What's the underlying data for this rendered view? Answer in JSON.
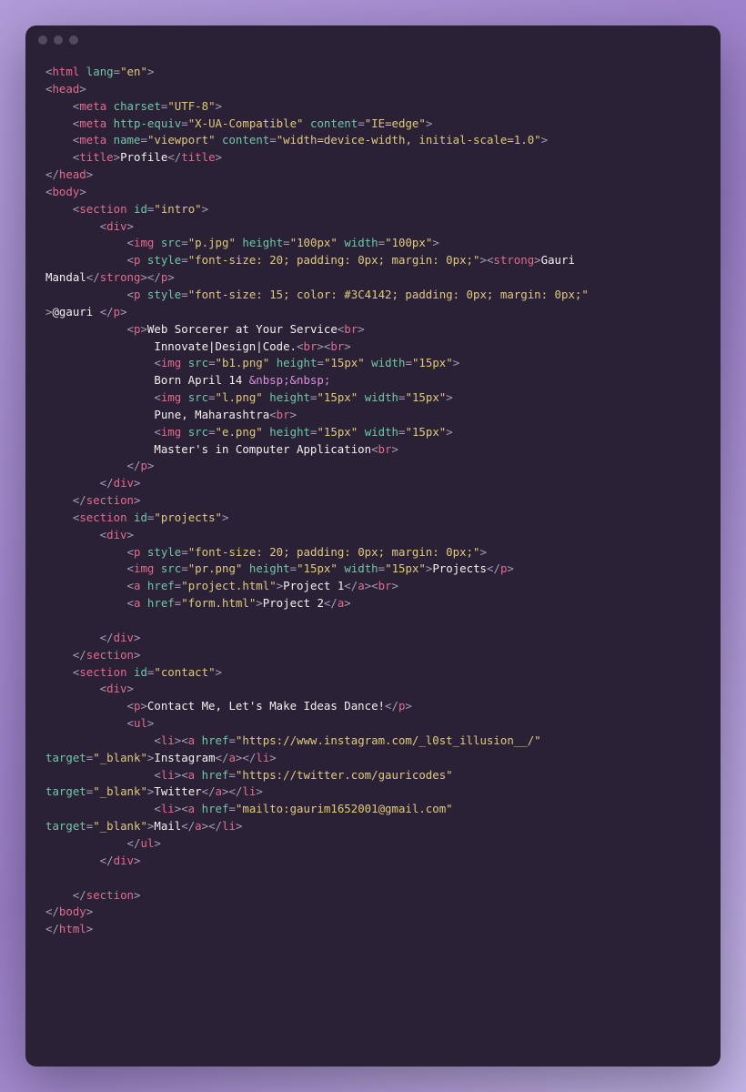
{
  "lines": [
    [
      [
        "c-punc",
        "<"
      ],
      [
        "c-tag",
        "html"
      ],
      [
        "c-punc",
        " "
      ],
      [
        "c-attr",
        "lang"
      ],
      [
        "c-punc",
        "="
      ],
      [
        "c-str",
        "\"en\""
      ],
      [
        "c-punc",
        ">"
      ]
    ],
    [
      [
        "c-punc",
        "<"
      ],
      [
        "c-tag",
        "head"
      ],
      [
        "c-punc",
        ">"
      ]
    ],
    [
      [
        "c-punc",
        "    <"
      ],
      [
        "c-tag",
        "meta"
      ],
      [
        "c-punc",
        " "
      ],
      [
        "c-attr",
        "charset"
      ],
      [
        "c-punc",
        "="
      ],
      [
        "c-str",
        "\"UTF-8\""
      ],
      [
        "c-punc",
        ">"
      ]
    ],
    [
      [
        "c-punc",
        "    <"
      ],
      [
        "c-tag",
        "meta"
      ],
      [
        "c-punc",
        " "
      ],
      [
        "c-attr",
        "http-equiv"
      ],
      [
        "c-punc",
        "="
      ],
      [
        "c-str",
        "\"X-UA-Compatible\""
      ],
      [
        "c-punc",
        " "
      ],
      [
        "c-attr",
        "content"
      ],
      [
        "c-punc",
        "="
      ],
      [
        "c-str",
        "\"IE=edge\""
      ],
      [
        "c-punc",
        ">"
      ]
    ],
    [
      [
        "c-punc",
        "    <"
      ],
      [
        "c-tag",
        "meta"
      ],
      [
        "c-punc",
        " "
      ],
      [
        "c-attr",
        "name"
      ],
      [
        "c-punc",
        "="
      ],
      [
        "c-str",
        "\"viewport\""
      ],
      [
        "c-punc",
        " "
      ],
      [
        "c-attr",
        "content"
      ],
      [
        "c-punc",
        "="
      ],
      [
        "c-str",
        "\"width=device-width, initial-scale=1.0\""
      ],
      [
        "c-punc",
        ">"
      ]
    ],
    [
      [
        "c-punc",
        "    <"
      ],
      [
        "c-tag",
        "title"
      ],
      [
        "c-punc",
        ">"
      ],
      [
        "c-text",
        "Profile"
      ],
      [
        "c-punc",
        "</"
      ],
      [
        "c-tag",
        "title"
      ],
      [
        "c-punc",
        ">"
      ]
    ],
    [
      [
        "c-punc",
        "</"
      ],
      [
        "c-tag",
        "head"
      ],
      [
        "c-punc",
        ">"
      ]
    ],
    [
      [
        "c-punc",
        "<"
      ],
      [
        "c-tag",
        "body"
      ],
      [
        "c-punc",
        ">"
      ]
    ],
    [
      [
        "c-punc",
        "    <"
      ],
      [
        "c-tag",
        "section"
      ],
      [
        "c-punc",
        " "
      ],
      [
        "c-attr",
        "id"
      ],
      [
        "c-punc",
        "="
      ],
      [
        "c-str",
        "\"intro\""
      ],
      [
        "c-punc",
        ">"
      ]
    ],
    [
      [
        "c-punc",
        "        <"
      ],
      [
        "c-tag",
        "div"
      ],
      [
        "c-punc",
        ">"
      ]
    ],
    [
      [
        "c-punc",
        "            <"
      ],
      [
        "c-tag",
        "img"
      ],
      [
        "c-punc",
        " "
      ],
      [
        "c-attr",
        "src"
      ],
      [
        "c-punc",
        "="
      ],
      [
        "c-str",
        "\"p.jpg\""
      ],
      [
        "c-punc",
        " "
      ],
      [
        "c-attr",
        "height"
      ],
      [
        "c-punc",
        "="
      ],
      [
        "c-str",
        "\"100px\""
      ],
      [
        "c-punc",
        " "
      ],
      [
        "c-attr",
        "width"
      ],
      [
        "c-punc",
        "="
      ],
      [
        "c-str",
        "\"100px\""
      ],
      [
        "c-punc",
        ">"
      ]
    ],
    [
      [
        "c-punc",
        "            <"
      ],
      [
        "c-tag",
        "p"
      ],
      [
        "c-punc",
        " "
      ],
      [
        "c-attr",
        "style"
      ],
      [
        "c-punc",
        "="
      ],
      [
        "c-str",
        "\"font-size: 20; padding: 0px; margin: 0px;\""
      ],
      [
        "c-punc",
        "><"
      ],
      [
        "c-tag",
        "strong"
      ],
      [
        "c-punc",
        ">"
      ],
      [
        "c-text",
        "Gauri "
      ]
    ],
    [
      [
        "c-text",
        "Mandal"
      ],
      [
        "c-punc",
        "</"
      ],
      [
        "c-tag",
        "strong"
      ],
      [
        "c-punc",
        "></"
      ],
      [
        "c-tag",
        "p"
      ],
      [
        "c-punc",
        ">"
      ]
    ],
    [
      [
        "c-punc",
        "            <"
      ],
      [
        "c-tag",
        "p"
      ],
      [
        "c-punc",
        " "
      ],
      [
        "c-attr",
        "style"
      ],
      [
        "c-punc",
        "="
      ],
      [
        "c-str",
        "\"font-size: 15; color: #3C4142; padding: 0px; margin: 0px;\""
      ]
    ],
    [
      [
        "c-punc",
        ">"
      ],
      [
        "c-text",
        "@gauri "
      ],
      [
        "c-punc",
        "</"
      ],
      [
        "c-tag",
        "p"
      ],
      [
        "c-punc",
        ">"
      ]
    ],
    [
      [
        "c-punc",
        "            <"
      ],
      [
        "c-tag",
        "p"
      ],
      [
        "c-punc",
        ">"
      ],
      [
        "c-text",
        "Web Sorcerer at Your Service"
      ],
      [
        "c-punc",
        "<"
      ],
      [
        "c-tag",
        "br"
      ],
      [
        "c-punc",
        ">"
      ]
    ],
    [
      [
        "c-text",
        "                Innovate|Design|Code."
      ],
      [
        "c-punc",
        "<"
      ],
      [
        "c-tag",
        "br"
      ],
      [
        "c-punc",
        "><"
      ],
      [
        "c-tag",
        "br"
      ],
      [
        "c-punc",
        ">"
      ]
    ],
    [
      [
        "c-punc",
        "                <"
      ],
      [
        "c-tag",
        "img"
      ],
      [
        "c-punc",
        " "
      ],
      [
        "c-attr",
        "src"
      ],
      [
        "c-punc",
        "="
      ],
      [
        "c-str",
        "\"b1.png\""
      ],
      [
        "c-punc",
        " "
      ],
      [
        "c-attr",
        "height"
      ],
      [
        "c-punc",
        "="
      ],
      [
        "c-str",
        "\"15px\""
      ],
      [
        "c-punc",
        " "
      ],
      [
        "c-attr",
        "width"
      ],
      [
        "c-punc",
        "="
      ],
      [
        "c-str",
        "\"15px\""
      ],
      [
        "c-punc",
        ">"
      ]
    ],
    [
      [
        "c-text",
        "                Born April 14 "
      ],
      [
        "c-ent",
        "&nbsp;&nbsp;"
      ]
    ],
    [
      [
        "c-punc",
        "                <"
      ],
      [
        "c-tag",
        "img"
      ],
      [
        "c-punc",
        " "
      ],
      [
        "c-attr",
        "src"
      ],
      [
        "c-punc",
        "="
      ],
      [
        "c-str",
        "\"l.png\""
      ],
      [
        "c-punc",
        " "
      ],
      [
        "c-attr",
        "height"
      ],
      [
        "c-punc",
        "="
      ],
      [
        "c-str",
        "\"15px\""
      ],
      [
        "c-punc",
        " "
      ],
      [
        "c-attr",
        "width"
      ],
      [
        "c-punc",
        "="
      ],
      [
        "c-str",
        "\"15px\""
      ],
      [
        "c-punc",
        ">"
      ]
    ],
    [
      [
        "c-text",
        "                Pune, Maharashtra"
      ],
      [
        "c-punc",
        "<"
      ],
      [
        "c-tag",
        "br"
      ],
      [
        "c-punc",
        ">"
      ]
    ],
    [
      [
        "c-punc",
        "                <"
      ],
      [
        "c-tag",
        "img"
      ],
      [
        "c-punc",
        " "
      ],
      [
        "c-attr",
        "src"
      ],
      [
        "c-punc",
        "="
      ],
      [
        "c-str",
        "\"e.png\""
      ],
      [
        "c-punc",
        " "
      ],
      [
        "c-attr",
        "height"
      ],
      [
        "c-punc",
        "="
      ],
      [
        "c-str",
        "\"15px\""
      ],
      [
        "c-punc",
        " "
      ],
      [
        "c-attr",
        "width"
      ],
      [
        "c-punc",
        "="
      ],
      [
        "c-str",
        "\"15px\""
      ],
      [
        "c-punc",
        ">"
      ]
    ],
    [
      [
        "c-text",
        "                Master's in Computer Application"
      ],
      [
        "c-punc",
        "<"
      ],
      [
        "c-tag",
        "br"
      ],
      [
        "c-punc",
        ">"
      ]
    ],
    [
      [
        "c-punc",
        "            </"
      ],
      [
        "c-tag",
        "p"
      ],
      [
        "c-punc",
        ">"
      ]
    ],
    [
      [
        "c-punc",
        "        </"
      ],
      [
        "c-tag",
        "div"
      ],
      [
        "c-punc",
        ">"
      ]
    ],
    [
      [
        "c-punc",
        "    </"
      ],
      [
        "c-tag",
        "section"
      ],
      [
        "c-punc",
        ">"
      ]
    ],
    [
      [
        "c-punc",
        "    <"
      ],
      [
        "c-tag",
        "section"
      ],
      [
        "c-punc",
        " "
      ],
      [
        "c-attr",
        "id"
      ],
      [
        "c-punc",
        "="
      ],
      [
        "c-str",
        "\"projects\""
      ],
      [
        "c-punc",
        ">"
      ]
    ],
    [
      [
        "c-punc",
        "        <"
      ],
      [
        "c-tag",
        "div"
      ],
      [
        "c-punc",
        ">"
      ]
    ],
    [
      [
        "c-punc",
        "            <"
      ],
      [
        "c-tag",
        "p"
      ],
      [
        "c-punc",
        " "
      ],
      [
        "c-attr",
        "style"
      ],
      [
        "c-punc",
        "="
      ],
      [
        "c-str",
        "\"font-size: 20; padding: 0px; margin: 0px;\""
      ],
      [
        "c-punc",
        ">"
      ]
    ],
    [
      [
        "c-punc",
        "            <"
      ],
      [
        "c-tag",
        "img"
      ],
      [
        "c-punc",
        " "
      ],
      [
        "c-attr",
        "src"
      ],
      [
        "c-punc",
        "="
      ],
      [
        "c-str",
        "\"pr.png\""
      ],
      [
        "c-punc",
        " "
      ],
      [
        "c-attr",
        "height"
      ],
      [
        "c-punc",
        "="
      ],
      [
        "c-str",
        "\"15px\""
      ],
      [
        "c-punc",
        " "
      ],
      [
        "c-attr",
        "width"
      ],
      [
        "c-punc",
        "="
      ],
      [
        "c-str",
        "\"15px\""
      ],
      [
        "c-punc",
        ">"
      ],
      [
        "c-text",
        "Projects"
      ],
      [
        "c-punc",
        "</"
      ],
      [
        "c-tag",
        "p"
      ],
      [
        "c-punc",
        ">"
      ]
    ],
    [
      [
        "c-punc",
        "            <"
      ],
      [
        "c-tag",
        "a"
      ],
      [
        "c-punc",
        " "
      ],
      [
        "c-attr",
        "href"
      ],
      [
        "c-punc",
        "="
      ],
      [
        "c-str",
        "\"project.html\""
      ],
      [
        "c-punc",
        ">"
      ],
      [
        "c-text",
        "Project 1"
      ],
      [
        "c-punc",
        "</"
      ],
      [
        "c-tag",
        "a"
      ],
      [
        "c-punc",
        "><"
      ],
      [
        "c-tag",
        "br"
      ],
      [
        "c-punc",
        ">"
      ]
    ],
    [
      [
        "c-punc",
        "            <"
      ],
      [
        "c-tag",
        "a"
      ],
      [
        "c-punc",
        " "
      ],
      [
        "c-attr",
        "href"
      ],
      [
        "c-punc",
        "="
      ],
      [
        "c-str",
        "\"form.html\""
      ],
      [
        "c-punc",
        ">"
      ],
      [
        "c-text",
        "Project 2"
      ],
      [
        "c-punc",
        "</"
      ],
      [
        "c-tag",
        "a"
      ],
      [
        "c-punc",
        ">"
      ]
    ],
    [
      [
        "c-text",
        ""
      ]
    ],
    [
      [
        "c-punc",
        "        </"
      ],
      [
        "c-tag",
        "div"
      ],
      [
        "c-punc",
        ">"
      ]
    ],
    [
      [
        "c-punc",
        "    </"
      ],
      [
        "c-tag",
        "section"
      ],
      [
        "c-punc",
        ">"
      ]
    ],
    [
      [
        "c-punc",
        "    <"
      ],
      [
        "c-tag",
        "section"
      ],
      [
        "c-punc",
        " "
      ],
      [
        "c-attr",
        "id"
      ],
      [
        "c-punc",
        "="
      ],
      [
        "c-str",
        "\"contact\""
      ],
      [
        "c-punc",
        ">"
      ]
    ],
    [
      [
        "c-punc",
        "        <"
      ],
      [
        "c-tag",
        "div"
      ],
      [
        "c-punc",
        ">"
      ]
    ],
    [
      [
        "c-punc",
        "            <"
      ],
      [
        "c-tag",
        "p"
      ],
      [
        "c-punc",
        ">"
      ],
      [
        "c-text",
        "Contact Me, Let's Make Ideas Dance!"
      ],
      [
        "c-punc",
        "</"
      ],
      [
        "c-tag",
        "p"
      ],
      [
        "c-punc",
        ">"
      ]
    ],
    [
      [
        "c-punc",
        "            <"
      ],
      [
        "c-tag",
        "ul"
      ],
      [
        "c-punc",
        ">"
      ]
    ],
    [
      [
        "c-punc",
        "                <"
      ],
      [
        "c-tag",
        "li"
      ],
      [
        "c-punc",
        "><"
      ],
      [
        "c-tag",
        "a"
      ],
      [
        "c-punc",
        " "
      ],
      [
        "c-attr",
        "href"
      ],
      [
        "c-punc",
        "="
      ],
      [
        "c-str",
        "\"https://www.instagram.com/_l0st_illusion__/\""
      ],
      [
        "c-punc",
        " "
      ]
    ],
    [
      [
        "c-attr",
        "target"
      ],
      [
        "c-punc",
        "="
      ],
      [
        "c-str",
        "\"_blank\""
      ],
      [
        "c-punc",
        ">"
      ],
      [
        "c-text",
        "Instagram"
      ],
      [
        "c-punc",
        "</"
      ],
      [
        "c-tag",
        "a"
      ],
      [
        "c-punc",
        "></"
      ],
      [
        "c-tag",
        "li"
      ],
      [
        "c-punc",
        ">"
      ]
    ],
    [
      [
        "c-punc",
        "                <"
      ],
      [
        "c-tag",
        "li"
      ],
      [
        "c-punc",
        "><"
      ],
      [
        "c-tag",
        "a"
      ],
      [
        "c-punc",
        " "
      ],
      [
        "c-attr",
        "href"
      ],
      [
        "c-punc",
        "="
      ],
      [
        "c-str",
        "\"https://twitter.com/gauricodes\""
      ],
      [
        "c-punc",
        " "
      ]
    ],
    [
      [
        "c-attr",
        "target"
      ],
      [
        "c-punc",
        "="
      ],
      [
        "c-str",
        "\"_blank\""
      ],
      [
        "c-punc",
        ">"
      ],
      [
        "c-text",
        "Twitter"
      ],
      [
        "c-punc",
        "</"
      ],
      [
        "c-tag",
        "a"
      ],
      [
        "c-punc",
        "></"
      ],
      [
        "c-tag",
        "li"
      ],
      [
        "c-punc",
        ">"
      ]
    ],
    [
      [
        "c-punc",
        "                <"
      ],
      [
        "c-tag",
        "li"
      ],
      [
        "c-punc",
        "><"
      ],
      [
        "c-tag",
        "a"
      ],
      [
        "c-punc",
        " "
      ],
      [
        "c-attr",
        "href"
      ],
      [
        "c-punc",
        "="
      ],
      [
        "c-str",
        "\"mailto:gaurim1652001@gmail.com\""
      ],
      [
        "c-punc",
        " "
      ]
    ],
    [
      [
        "c-attr",
        "target"
      ],
      [
        "c-punc",
        "="
      ],
      [
        "c-str",
        "\"_blank\""
      ],
      [
        "c-punc",
        ">"
      ],
      [
        "c-text",
        "Mail"
      ],
      [
        "c-punc",
        "</"
      ],
      [
        "c-tag",
        "a"
      ],
      [
        "c-punc",
        "></"
      ],
      [
        "c-tag",
        "li"
      ],
      [
        "c-punc",
        ">"
      ]
    ],
    [
      [
        "c-punc",
        "            </"
      ],
      [
        "c-tag",
        "ul"
      ],
      [
        "c-punc",
        ">"
      ]
    ],
    [
      [
        "c-punc",
        "        </"
      ],
      [
        "c-tag",
        "div"
      ],
      [
        "c-punc",
        ">"
      ]
    ],
    [
      [
        "c-text",
        ""
      ]
    ],
    [
      [
        "c-punc",
        "    </"
      ],
      [
        "c-tag",
        "section"
      ],
      [
        "c-punc",
        ">"
      ]
    ],
    [
      [
        "c-punc",
        "</"
      ],
      [
        "c-tag",
        "body"
      ],
      [
        "c-punc",
        ">"
      ]
    ],
    [
      [
        "c-punc",
        "</"
      ],
      [
        "c-tag",
        "html"
      ],
      [
        "c-punc",
        ">"
      ]
    ]
  ]
}
